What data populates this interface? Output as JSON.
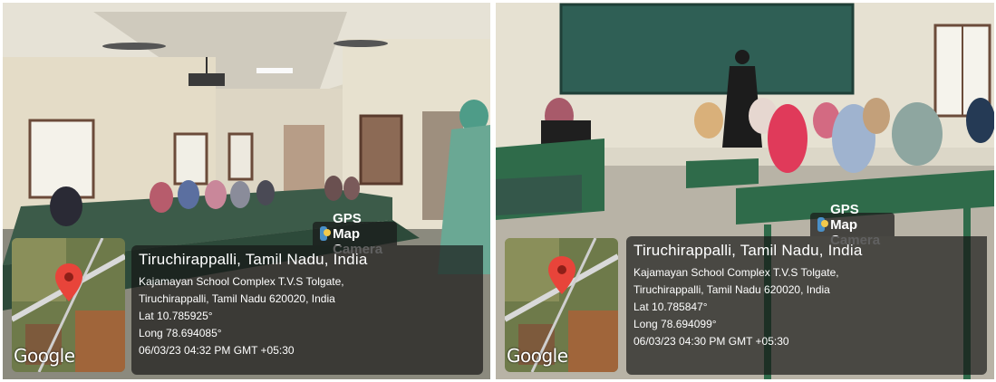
{
  "photos": [
    {
      "badge": "GPS Map Camera",
      "city": "Tiruchirappalli, Tamil Nadu, India",
      "address_line1": "Kajamayan School Complex T.V.S Tolgate,",
      "address_line2": "Tiruchirappalli, Tamil Nadu 620020, India",
      "lat": "Lat 10.785925°",
      "long": "Long 78.694085°",
      "datetime": "06/03/23 04:32 PM GMT +05:30",
      "map_logo": "Google"
    },
    {
      "badge": "GPS Map Camera",
      "city": "Tiruchirappalli, Tamil Nadu, India",
      "address_line1": "Kajamayan School Complex T.V.S Tolgate,",
      "address_line2": "Tiruchirappalli, Tamil Nadu 620020, India",
      "lat": "Lat 10.785847°",
      "long": "Long 78.694099°",
      "datetime": "06/03/23 04:30 PM GMT +05:30",
      "map_logo": "Google"
    }
  ],
  "colors": {
    "pin": "#e8443a",
    "overlay": "#1a1a1a",
    "chalkboard": "#2f5f55",
    "bench": "#2f6b4a"
  },
  "icons": {
    "pin": "map-pin-icon",
    "badge": "gps-camera-icon"
  }
}
